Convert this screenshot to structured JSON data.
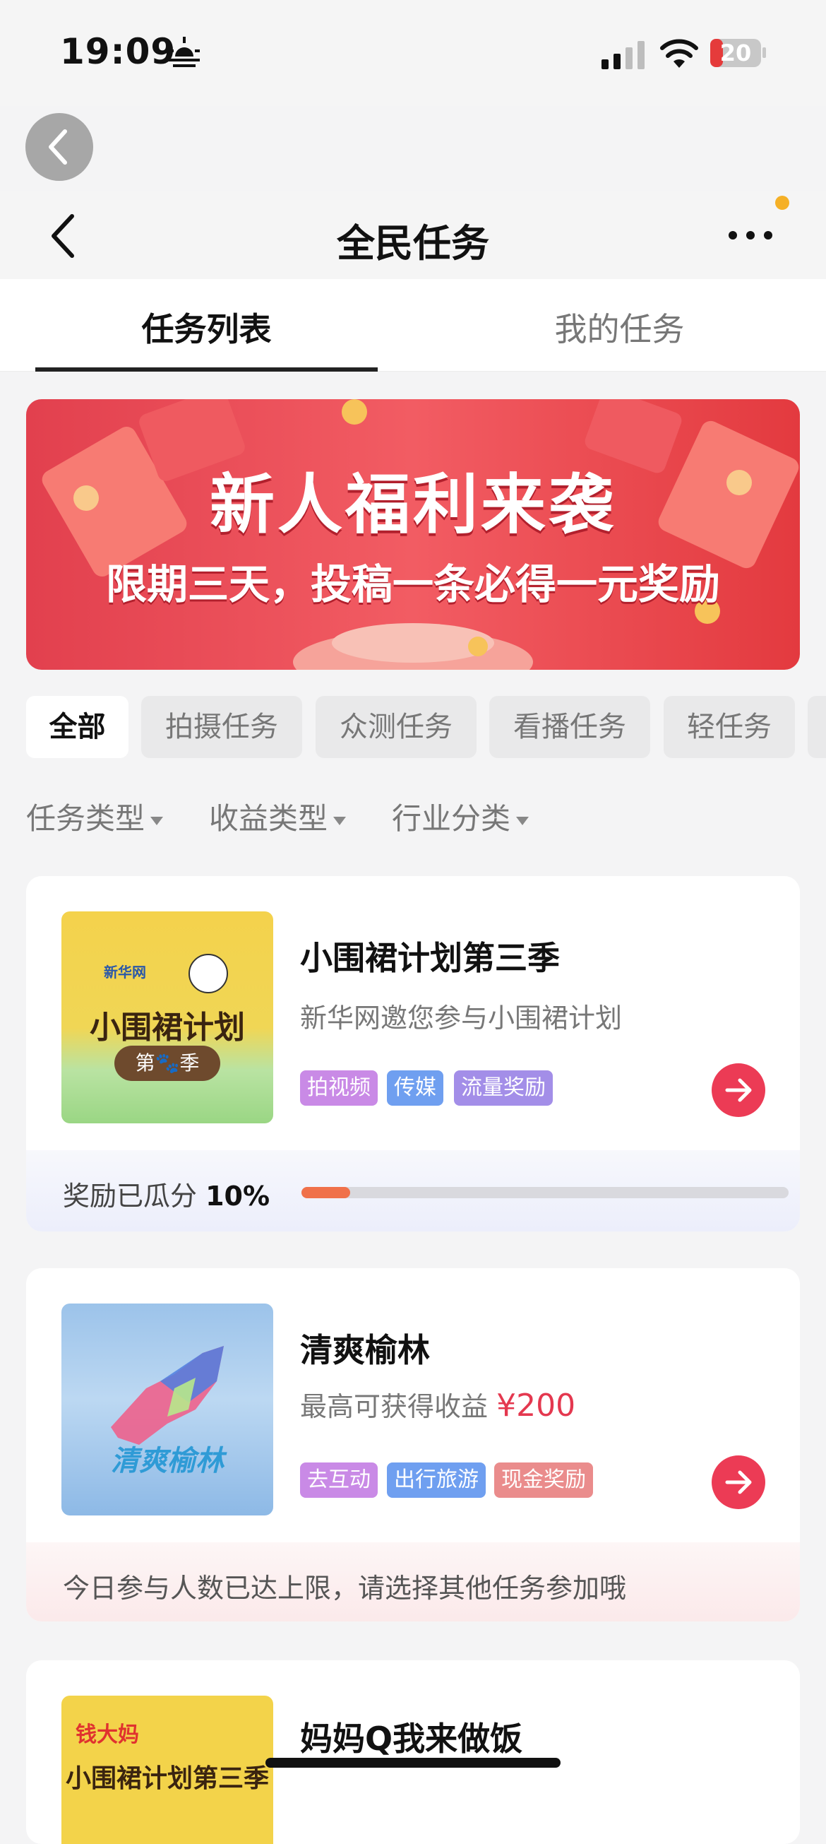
{
  "status_bar": {
    "time": "19:09",
    "battery": "20"
  },
  "header": {
    "title": "全民任务"
  },
  "tabs": [
    {
      "label": "任务列表",
      "active": true
    },
    {
      "label": "我的任务",
      "active": false
    }
  ],
  "banner": {
    "line1": "新人福利来袭",
    "line2": "限期三天，投稿一条必得一元奖励"
  },
  "chips": [
    {
      "label": "全部",
      "active": true
    },
    {
      "label": "拍摄任务"
    },
    {
      "label": "众测任务"
    },
    {
      "label": "看播任务"
    },
    {
      "label": "轻任务"
    }
  ],
  "dropdowns": [
    "任务类型",
    "收益类型",
    "行业分类"
  ],
  "tasks": [
    {
      "title": "小围裙计划第三季",
      "subtitle": "新华网邀您参与小围裙计划",
      "thumb_logo": "新华网",
      "thumb_title": "小围裙计划",
      "thumb_season": "第🐾季",
      "tags": [
        {
          "label": "拍视频",
          "color": "#c98ae6"
        },
        {
          "label": "传媒",
          "color": "#6f9ff0"
        },
        {
          "label": "流量奖励",
          "color": "#a38ee8"
        }
      ],
      "progress_label": "奖励已瓜分",
      "progress_value": "10%",
      "progress_fraction": 0.1
    },
    {
      "title": "清爽榆林",
      "subtitle": "最高可获得收益",
      "price": "¥200",
      "thumb_text": "清爽榆林",
      "tags": [
        {
          "label": "去互动",
          "color": "#c98ae6"
        },
        {
          "label": "出行旅游",
          "color": "#6f9ff0"
        },
        {
          "label": "现金奖励",
          "color": "#ea8c8c"
        }
      ],
      "notice": "今日参与人数已达上限，请选择其他任务参加哦"
    },
    {
      "title": "妈妈Q我来做饭",
      "thumb_logo": "钱大妈",
      "thumb_title": "小围裙计划第三季"
    }
  ],
  "colors": {
    "accent": "#ec3b55",
    "progress": "#f0714a"
  }
}
